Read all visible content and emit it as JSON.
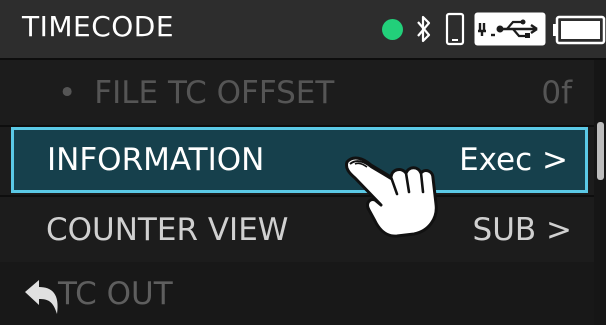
{
  "header": {
    "title": "TIMECODE",
    "status_icons": [
      "status-dot-icon",
      "bluetooth-icon",
      "phone-icon",
      "usb-icon",
      "battery-icon"
    ],
    "status_color": "#22d07a"
  },
  "menu": {
    "items": [
      {
        "label": "FILE TC OFFSET",
        "value": "0f",
        "state": "disabled"
      },
      {
        "label": "INFORMATION",
        "value": "Exec >",
        "state": "selected"
      },
      {
        "label": "COUNTER VIEW",
        "value": "SUB >",
        "state": "normal"
      }
    ]
  },
  "footer": {
    "label": "TC OUT",
    "back_icon": "back-arrow-icon"
  },
  "overlay": {
    "icon": "tap-hand-icon"
  },
  "colors": {
    "accent": "#5bc9e6",
    "selected_bg": "#16404c",
    "header_bg": "#2d2d2d",
    "body_bg": "#1c1c1c"
  }
}
